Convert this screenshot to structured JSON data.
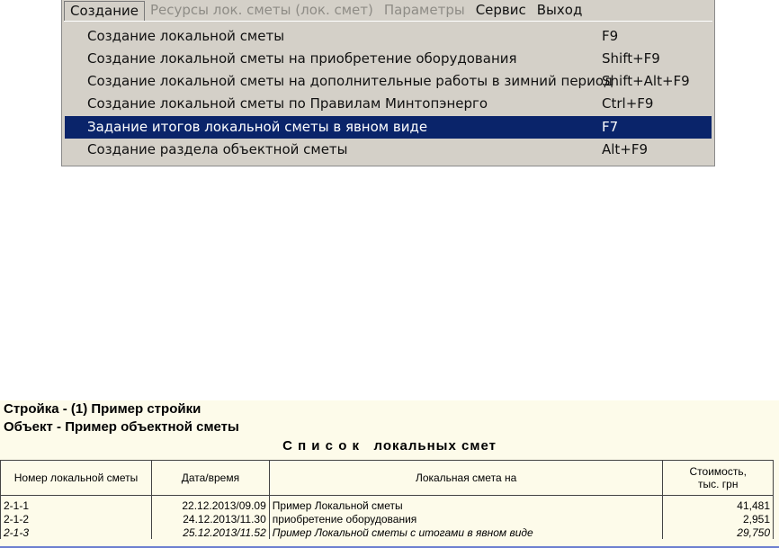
{
  "menubar": {
    "items": [
      {
        "label": "Создание",
        "state": "active"
      },
      {
        "label": "Ресурсы лок. сметы (лок. смет)",
        "state": "disabled"
      },
      {
        "label": "Параметры",
        "state": "disabled"
      },
      {
        "label": "Сервис",
        "state": "normal"
      },
      {
        "label": "Выход",
        "state": "normal"
      }
    ]
  },
  "dropdown": {
    "items": [
      {
        "label": "Создание локальной сметы",
        "shortcut": "F9"
      },
      {
        "label": "Создание локальной сметы на приобретение оборудования",
        "shortcut": "Shift+F9"
      },
      {
        "label": "Создание локальной сметы на дополнительные работы в зимний период",
        "shortcut": "Shift+Alt+F9"
      },
      {
        "label": "Создание локальной сметы по Правилам Минтопэнерго",
        "shortcut": "Ctrl+F9"
      },
      {
        "label": "Задание итогов локальной сметы в явном виде",
        "shortcut": "F7",
        "highlighted": true
      },
      {
        "label": "Создание раздела объектной сметы",
        "shortcut": "Alt+F9"
      }
    ]
  },
  "report": {
    "line1": "Стройка - (1) Пример стройки",
    "line2": "Объект - Пример объектной сметы",
    "title": "С п и с о к   локальных смет",
    "columns": {
      "number": "Номер локальной сметы",
      "date": "Дата/время",
      "name": "Локальная смета на",
      "cost_line1": "Стоимость,",
      "cost_line2": "тыс. грн"
    },
    "rows": [
      {
        "number": "2-1-1",
        "date": "22.12.2013/09.09",
        "name": "Пример Локальной сметы",
        "cost": "41,481"
      },
      {
        "number": "2-1-2",
        "date": "24.12.2013/11.30",
        "name": "приобретение оборудования",
        "cost": "2,951"
      },
      {
        "number": "2-1-3",
        "date": "25.12.2013/11.52",
        "name": "Пример Локальной сметы с итогами в явном виде",
        "cost": "29,750"
      }
    ]
  },
  "colors": {
    "highlight": "#0a246a",
    "menu_bg": "#d4d0c8",
    "report_bg": "#fdfbea"
  }
}
